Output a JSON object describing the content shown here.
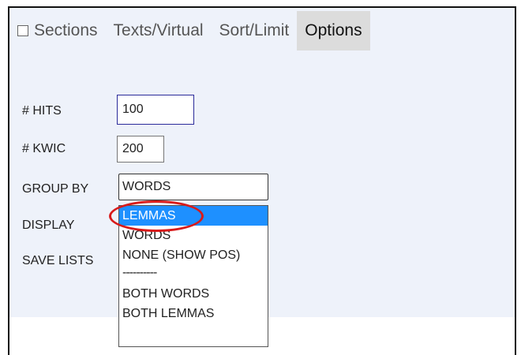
{
  "tabs": [
    {
      "label": "Sections",
      "has_checkbox": true
    },
    {
      "label": "Texts/Virtual"
    },
    {
      "label": "Sort/Limit"
    },
    {
      "label": "Options",
      "active": true
    }
  ],
  "form": {
    "hits": {
      "label": "# HITS",
      "value": "100"
    },
    "kwic": {
      "label": "# KWIC",
      "value": "200"
    },
    "group_by": {
      "label": "GROUP BY",
      "value": "WORDS"
    },
    "display": {
      "label": "DISPLAY"
    },
    "save_lists": {
      "label": "SAVE LISTS"
    }
  },
  "dropdown": {
    "options": [
      "LEMMAS",
      "WORDS",
      "NONE (SHOW POS)",
      "----------",
      "BOTH WORDS",
      "BOTH LEMMAS"
    ],
    "highlighted": "LEMMAS"
  },
  "annotation": {
    "color": "#d81b1b"
  },
  "colors": {
    "selected_bg": "#1e90ff",
    "panel_bg": "#eef2fa",
    "active_tab_bg": "#dcdcdc"
  }
}
